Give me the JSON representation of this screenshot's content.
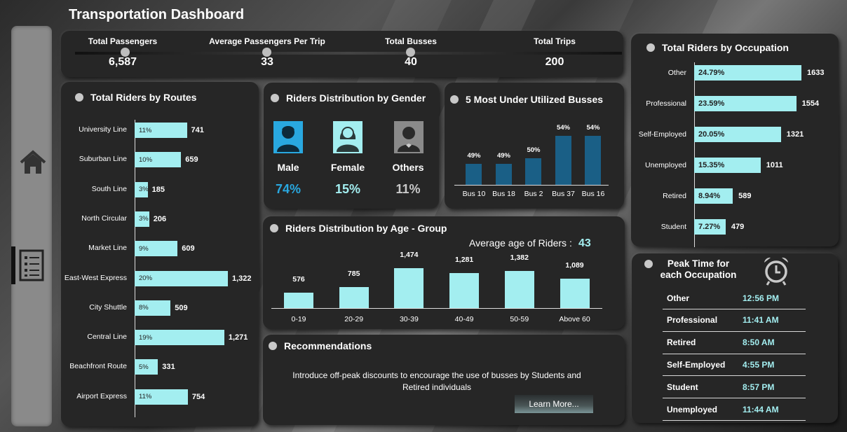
{
  "title": "Transportation Dashboard",
  "kpis": [
    {
      "label": "Total Passengers",
      "value": "6,587"
    },
    {
      "label": "Average Passengers Per Trip",
      "value": "33"
    },
    {
      "label": "Total Busses",
      "value": "40"
    },
    {
      "label": "Total Trips",
      "value": "200"
    }
  ],
  "routes": {
    "title": "Total Riders by Routes",
    "accent": "#a3eef0",
    "items": [
      {
        "name": "University Line",
        "pct": "11%",
        "value": "741",
        "count": 741
      },
      {
        "name": "Suburban Line",
        "pct": "10%",
        "value": "659",
        "count": 659
      },
      {
        "name": "South Line",
        "pct": "3%",
        "value": "185",
        "count": 185
      },
      {
        "name": "North Circular",
        "pct": "3%",
        "value": "206",
        "count": 206
      },
      {
        "name": "Market Line",
        "pct": "9%",
        "value": "609",
        "count": 609
      },
      {
        "name": "East-West Express",
        "pct": "20%",
        "value": "1,322",
        "count": 1322
      },
      {
        "name": "City Shuttle",
        "pct": "8%",
        "value": "509",
        "count": 509
      },
      {
        "name": "Central Line",
        "pct": "19%",
        "value": "1,271",
        "count": 1271
      },
      {
        "name": "Beachfront Route",
        "pct": "5%",
        "value": "331",
        "count": 331
      },
      {
        "name": "Airport Express",
        "pct": "11%",
        "value": "754",
        "count": 754
      }
    ]
  },
  "gender": {
    "title": "Riders Distribution by Gender",
    "items": [
      {
        "label": "Male",
        "pct": "74%",
        "icon": "male-user-icon",
        "icon_bg": "#29a8e0",
        "color": "#29a8e0"
      },
      {
        "label": "Female",
        "pct": "15%",
        "icon": "female-user-icon",
        "icon_bg": "#a3eef0",
        "color": "#a3eef0"
      },
      {
        "label": "Others",
        "pct": "11%",
        "icon": "other-user-icon",
        "icon_bg": "#8a8a8a",
        "color": "#c8c8c8"
      }
    ]
  },
  "underutilized": {
    "title": "5 Most Under Utilized Busses",
    "accent": "#1a5f86",
    "items": [
      {
        "bus": "Bus 10",
        "label": "49%",
        "value": 49
      },
      {
        "bus": "Bus 18",
        "label": "49%",
        "value": 49
      },
      {
        "bus": "Bus 2",
        "label": "50%",
        "value": 50
      },
      {
        "bus": "Bus 37",
        "label": "54%",
        "value": 54
      },
      {
        "bus": "Bus 16",
        "label": "54%",
        "value": 54
      }
    ]
  },
  "age": {
    "title": "Riders Distribution by Age - Group",
    "avg_label": "Average age of Riders :",
    "avg_value": "43",
    "accent": "#a3eef0",
    "items": [
      {
        "group": "0-19",
        "label": "576",
        "value": 576
      },
      {
        "group": "20-29",
        "label": "785",
        "value": 785
      },
      {
        "group": "30-39",
        "label": "1,474",
        "value": 1474
      },
      {
        "group": "40-49",
        "label": "1,281",
        "value": 1281
      },
      {
        "group": "50-59",
        "label": "1,382",
        "value": 1382
      },
      {
        "group": "Above 60",
        "label": "1,089",
        "value": 1089
      }
    ]
  },
  "recommendations": {
    "title": "Recommendations",
    "text": "Introduce off-peak discounts to encourage the use of busses by Students and Retired individuals",
    "button": "Learn More..."
  },
  "occupation": {
    "title": "Total Riders by Occupation",
    "accent": "#a3eef0",
    "items": [
      {
        "name": "Other",
        "pct": "24.79%",
        "value": "1633",
        "count": 1633
      },
      {
        "name": "Professional",
        "pct": "23.59%",
        "value": "1554",
        "count": 1554
      },
      {
        "name": "Self-Employed",
        "pct": "20.05%",
        "value": "1321",
        "count": 1321
      },
      {
        "name": "Unemployed",
        "pct": "15.35%",
        "value": "1011",
        "count": 1011
      },
      {
        "name": "Retired",
        "pct": "8.94%",
        "value": "589",
        "count": 589
      },
      {
        "name": "Student",
        "pct": "7.27%",
        "value": "479",
        "count": 479
      }
    ]
  },
  "peak": {
    "title_line1": "Peak Time for",
    "title_line2": "each Occupation",
    "icon": "alarm-clock-icon",
    "rows": [
      {
        "occupation": "Other",
        "time": "12:56 PM"
      },
      {
        "occupation": "Professional",
        "time": "11:41 AM"
      },
      {
        "occupation": "Retired",
        "time": "8:50 AM"
      },
      {
        "occupation": "Self-Employed",
        "time": "4:55 PM"
      },
      {
        "occupation": "Student",
        "time": "8:57 PM"
      },
      {
        "occupation": "Unemployed",
        "time": "11:44 AM"
      }
    ]
  },
  "sidebar": {
    "items": [
      {
        "icon": "home-icon"
      },
      {
        "icon": "report-list-icon"
      }
    ]
  }
}
